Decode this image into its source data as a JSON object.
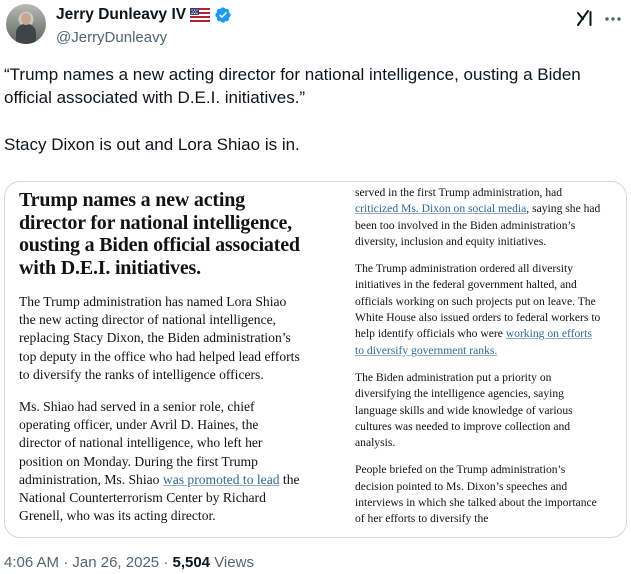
{
  "author": {
    "name": "Jerry Dunleavy IV",
    "handle": "@JerryDunleavy",
    "flag": "🇺🇸"
  },
  "tweet": {
    "text_1": "“Trump names a new acting director for national intelligence, ousting a Biden official associated with D.E.I. initiatives.”",
    "text_2": "Stacy Dixon is out and Lora Shiao is in."
  },
  "article": {
    "headline": "Trump names a new acting director for national intelligence, ousting a Biden official associated with D.E.I. initiatives.",
    "p1": "The Trump administration has named Lora Shiao the new acting director of national intelligence, replacing Stacy Dixon, the Biden administration’s top deputy in the office who had helped lead efforts to diversify the ranks of intelligence officers.",
    "p2_a": "Ms. Shiao had served in a senior role, chief operating officer, under Avril D. Haines, the director of national intelligence, who left her position on Monday. During the first Trump administration, Ms. Shiao ",
    "p2_link": "was promoted to lead",
    "p2_b": " the National Counterterrorism Center by Richard Grenell, who was its acting director.",
    "r1_a": "served in the first Trump administration, had ",
    "r1_link": "criticized Ms. Dixon on social media",
    "r1_b": ", saying she had been too involved in the Biden administration’s diversity, inclusion and equity initiatives.",
    "r2_a": "The Trump administration ordered all diversity initiatives in the federal government halted, and officials working on such projects put on leave. The White House also issued orders to federal workers to help identify officials who were ",
    "r2_link": "working on efforts to diversify government ranks.",
    "r3": "The Biden administration put a priority on diversifying the intelligence agencies, saying language skills and wide knowledge of various cultures was needed to improve collection and analysis.",
    "r4": "People briefed on the Trump administration’s decision pointed to Ms. Dixon’s speeches and interviews in which she talked about the importance of her efforts to diversify the"
  },
  "meta": {
    "time": "4:06 AM",
    "separator": "·",
    "date": "Jan 26, 2025",
    "views_count": "5,504",
    "views_label": "Views"
  },
  "icons": {
    "verified": "verified-badge-icon",
    "grok": "grok-icon",
    "more": "more-options-icon"
  },
  "colors": {
    "text_primary": "#0f1419",
    "text_secondary": "#536471",
    "verified_blue": "#1d9bf0",
    "article_link": "#326891",
    "border": "#cfd9de"
  }
}
